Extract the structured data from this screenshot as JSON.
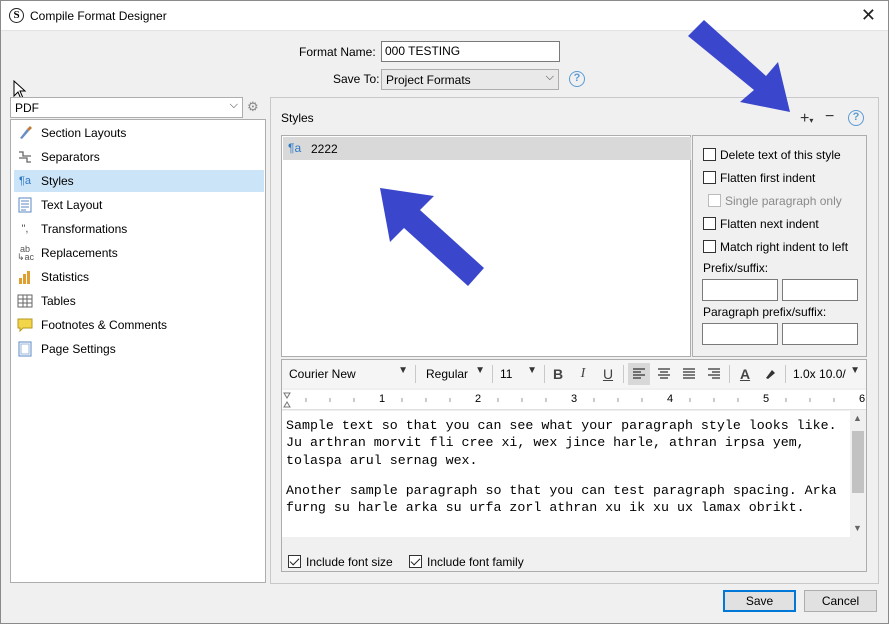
{
  "window": {
    "title": "Compile Format Designer",
    "close_glyph": "✕"
  },
  "header": {
    "format_name_label": "Format Name:",
    "format_name_value": "000 TESTING",
    "save_to_label": "Save To:",
    "save_to_value": "Project Formats"
  },
  "output": {
    "selected": "PDF"
  },
  "sidebar": {
    "items": [
      {
        "label": "Section Layouts",
        "icon": "paintbrush-icon"
      },
      {
        "label": "Separators",
        "icon": "separators-icon"
      },
      {
        "label": "Styles",
        "icon": "pilcrow-icon",
        "selected": true
      },
      {
        "label": "Text Layout",
        "icon": "text-layout-icon"
      },
      {
        "label": "Transformations",
        "icon": "quotes-icon"
      },
      {
        "label": "Replacements",
        "icon": "replace-icon"
      },
      {
        "label": "Statistics",
        "icon": "bar-chart-icon"
      },
      {
        "label": "Tables",
        "icon": "table-icon"
      },
      {
        "label": "Footnotes & Comments",
        "icon": "comment-icon"
      },
      {
        "label": "Page Settings",
        "icon": "page-icon"
      }
    ]
  },
  "styles_panel": {
    "heading": "Styles",
    "items": [
      {
        "label": "2222",
        "selected": true
      }
    ],
    "options": {
      "delete_text": "Delete text of this style",
      "flatten_first": "Flatten first indent",
      "single_paragraph": "Single paragraph only",
      "flatten_next": "Flatten next indent",
      "match_right": "Match right indent to left",
      "prefix_suffix_label": "Prefix/suffix:",
      "paragraph_prefix_suffix_label": "Paragraph prefix/suffix:"
    }
  },
  "editor": {
    "font_family": "Courier New",
    "font_style": "Regular",
    "font_size": "11",
    "line_spacing": "1.0x 10.0/",
    "ruler_numbers": [
      "1",
      "2",
      "3",
      "4",
      "5",
      "6"
    ],
    "paragraphs": [
      "Sample text so that you can see what your paragraph style looks like. Ju arthran morvit fli cree xi, wex jince harle, athran irpsa yem, tolaspa arul sernag wex.",
      "Another sample paragraph so that you can test paragraph spacing. Arka furng su harle arka su urfa zorl athran xu ik xu ux lamax obrikt."
    ],
    "include_font_size": "Include font size",
    "include_font_family": "Include font family"
  },
  "buttons": {
    "save": "Save",
    "cancel": "Cancel"
  },
  "colors": {
    "accent": "#0078d7",
    "selection": "#cce4f7",
    "arrow": "#3a47cc"
  }
}
